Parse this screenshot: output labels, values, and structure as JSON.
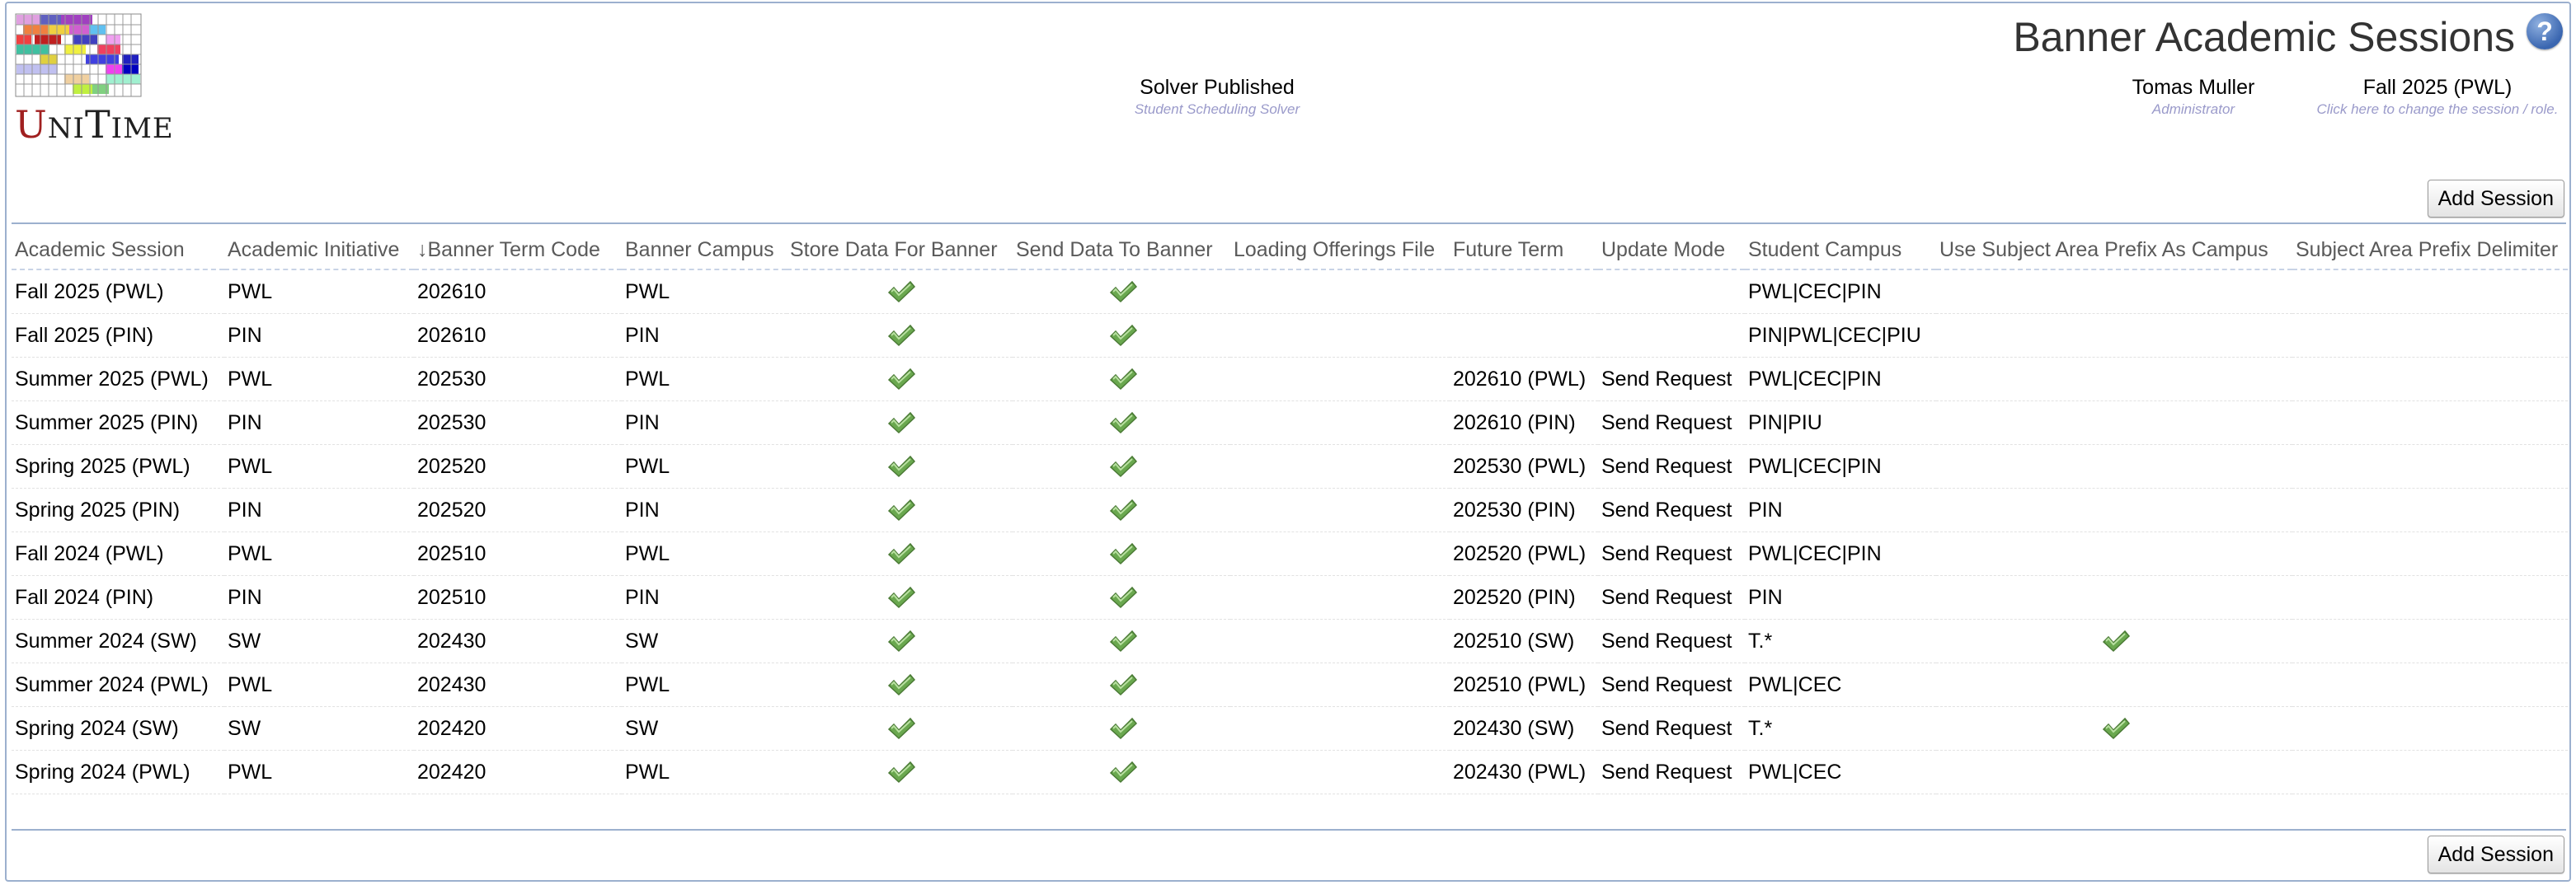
{
  "app": {
    "logo_text_u": "U",
    "logo_text_ni": "NI",
    "logo_text_t": "T",
    "logo_text_ime": "IME"
  },
  "header": {
    "title": "Banner Academic Sessions",
    "help_icon": "?",
    "solver": {
      "main": "Solver Published",
      "sub": "Student Scheduling Solver"
    },
    "user": {
      "main": "Tomas Muller",
      "sub": "Administrator"
    },
    "session": {
      "main": "Fall 2025 (PWL)",
      "sub": "Click here to change the session / role."
    }
  },
  "buttons": {
    "add_session": "Add Session"
  },
  "table": {
    "columns": [
      "Academic Session",
      "Academic Initiative",
      "↓Banner Term Code",
      "Banner Campus",
      "Store Data For Banner",
      "Send Data To Banner",
      "Loading Offerings File",
      "Future Term",
      "Update Mode",
      "Student Campus",
      "Use Subject Area Prefix As Campus",
      "Subject Area Prefix Delimiter"
    ],
    "rows": [
      {
        "session": "Fall 2025 (PWL)",
        "initiative": "PWL",
        "term": "202610",
        "campus": "PWL",
        "store": true,
        "send": true,
        "loading": "",
        "future": "",
        "mode": "",
        "student_campus": "PWL|CEC|PIN",
        "prefix": false,
        "delim": ""
      },
      {
        "session": "Fall 2025 (PIN)",
        "initiative": "PIN",
        "term": "202610",
        "campus": "PIN",
        "store": true,
        "send": true,
        "loading": "",
        "future": "",
        "mode": "",
        "student_campus": "PIN|PWL|CEC|PIU",
        "prefix": false,
        "delim": ""
      },
      {
        "session": "Summer 2025 (PWL)",
        "initiative": "PWL",
        "term": "202530",
        "campus": "PWL",
        "store": true,
        "send": true,
        "loading": "",
        "future": "202610 (PWL)",
        "mode": "Send Request",
        "student_campus": "PWL|CEC|PIN",
        "prefix": false,
        "delim": ""
      },
      {
        "session": "Summer 2025 (PIN)",
        "initiative": "PIN",
        "term": "202530",
        "campus": "PIN",
        "store": true,
        "send": true,
        "loading": "",
        "future": "202610 (PIN)",
        "mode": "Send Request",
        "student_campus": "PIN|PIU",
        "prefix": false,
        "delim": ""
      },
      {
        "session": "Spring 2025 (PWL)",
        "initiative": "PWL",
        "term": "202520",
        "campus": "PWL",
        "store": true,
        "send": true,
        "loading": "",
        "future": "202530 (PWL)",
        "mode": "Send Request",
        "student_campus": "PWL|CEC|PIN",
        "prefix": false,
        "delim": ""
      },
      {
        "session": "Spring 2025 (PIN)",
        "initiative": "PIN",
        "term": "202520",
        "campus": "PIN",
        "store": true,
        "send": true,
        "loading": "",
        "future": "202530 (PIN)",
        "mode": "Send Request",
        "student_campus": "PIN",
        "prefix": false,
        "delim": ""
      },
      {
        "session": "Fall 2024 (PWL)",
        "initiative": "PWL",
        "term": "202510",
        "campus": "PWL",
        "store": true,
        "send": true,
        "loading": "",
        "future": "202520 (PWL)",
        "mode": "Send Request",
        "student_campus": "PWL|CEC|PIN",
        "prefix": false,
        "delim": ""
      },
      {
        "session": "Fall 2024 (PIN)",
        "initiative": "PIN",
        "term": "202510",
        "campus": "PIN",
        "store": true,
        "send": true,
        "loading": "",
        "future": "202520 (PIN)",
        "mode": "Send Request",
        "student_campus": "PIN",
        "prefix": false,
        "delim": ""
      },
      {
        "session": "Summer 2024 (SW)",
        "initiative": "SW",
        "term": "202430",
        "campus": "SW",
        "store": true,
        "send": true,
        "loading": "",
        "future": "202510 (SW)",
        "mode": "Send Request",
        "student_campus": "T.*",
        "prefix": true,
        "delim": ""
      },
      {
        "session": "Summer 2024 (PWL)",
        "initiative": "PWL",
        "term": "202430",
        "campus": "PWL",
        "store": true,
        "send": true,
        "loading": "",
        "future": "202510 (PWL)",
        "mode": "Send Request",
        "student_campus": "PWL|CEC",
        "prefix": false,
        "delim": ""
      },
      {
        "session": "Spring 2024 (SW)",
        "initiative": "SW",
        "term": "202420",
        "campus": "SW",
        "store": true,
        "send": true,
        "loading": "",
        "future": "202430 (SW)",
        "mode": "Send Request",
        "student_campus": "T.*",
        "prefix": true,
        "delim": ""
      },
      {
        "session": "Spring 2024 (PWL)",
        "initiative": "PWL",
        "term": "202420",
        "campus": "PWL",
        "store": true,
        "send": true,
        "loading": "",
        "future": "202430 (PWL)",
        "mode": "Send Request",
        "student_campus": "PWL|CEC",
        "prefix": false,
        "delim": ""
      }
    ]
  },
  "colors": {
    "border": "#9cb0ce",
    "header_text": "#5a5a5a",
    "check_green": "#6aa84f",
    "subtitle": "#9a9aca"
  },
  "icons": {
    "check": "check-icon",
    "help": "help-icon",
    "logo": "unitime-logo"
  }
}
